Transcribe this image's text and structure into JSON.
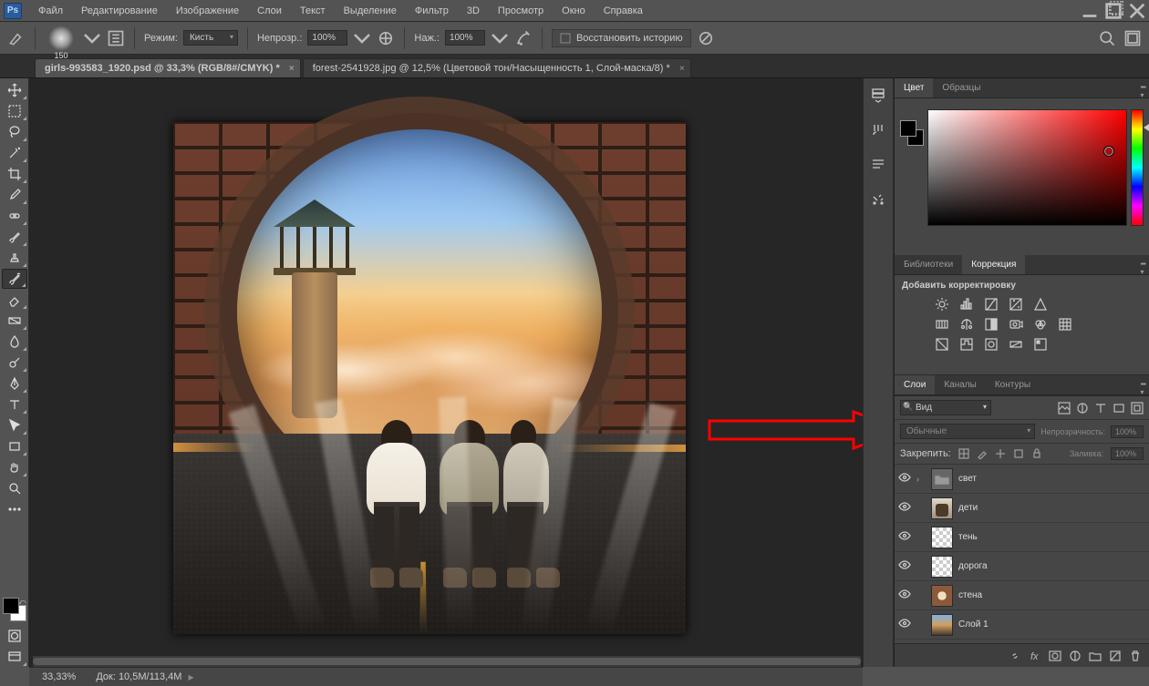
{
  "app": {
    "logo": "Ps"
  },
  "menu": {
    "file": "Файл",
    "edit": "Редактирование",
    "image": "Изображение",
    "layers": "Слои",
    "text": "Текст",
    "select": "Выделение",
    "filter": "Фильтр",
    "threed": "3D",
    "view": "Просмотр",
    "window": "Окно",
    "help": "Справка"
  },
  "options": {
    "brush_size": "150",
    "mode_label": "Режим:",
    "mode_value": "Кисть",
    "opacity_label": "Непрозр.:",
    "opacity_value": "100%",
    "flow_label": "Наж.:",
    "flow_value": "100%",
    "history_placeholder": "Восстановить историю"
  },
  "tabs": {
    "active": "girls-993583_1920.psd @ 33,3% (RGB/8#/CMYK) *",
    "inactive": "forest-2541928.jpg @ 12,5% (Цветовой тон/Насыщенность 1, Слой-маска/8) *"
  },
  "right_panels": {
    "color_tab": "Цвет",
    "swatches_tab": "Образцы",
    "libraries_tab": "Библиотеки",
    "correction_tab": "Коррекция",
    "adjustments_title": "Добавить корректировку",
    "layers_tab": "Слои",
    "channels_tab": "Каналы",
    "paths_tab": "Контуры",
    "filter_kind": "Вид",
    "blend_mode": "Обычные",
    "opacity_label": "Непрозрачность:",
    "opacity_value": "100%",
    "lock_label": "Закрепить:",
    "fill_label": "Заливка:",
    "fill_value": "100%"
  },
  "layers": [
    {
      "name": "свет",
      "type": "folder"
    },
    {
      "name": "дети",
      "type": "img-kids"
    },
    {
      "name": "тень",
      "type": "checker"
    },
    {
      "name": "дорога",
      "type": "checker"
    },
    {
      "name": "стена",
      "type": "img-wall"
    },
    {
      "name": "Слой 1",
      "type": "img-src"
    }
  ],
  "status": {
    "zoom": "33,33%",
    "doc_label": "Док:",
    "doc_size": "10,5M/113,4M"
  }
}
